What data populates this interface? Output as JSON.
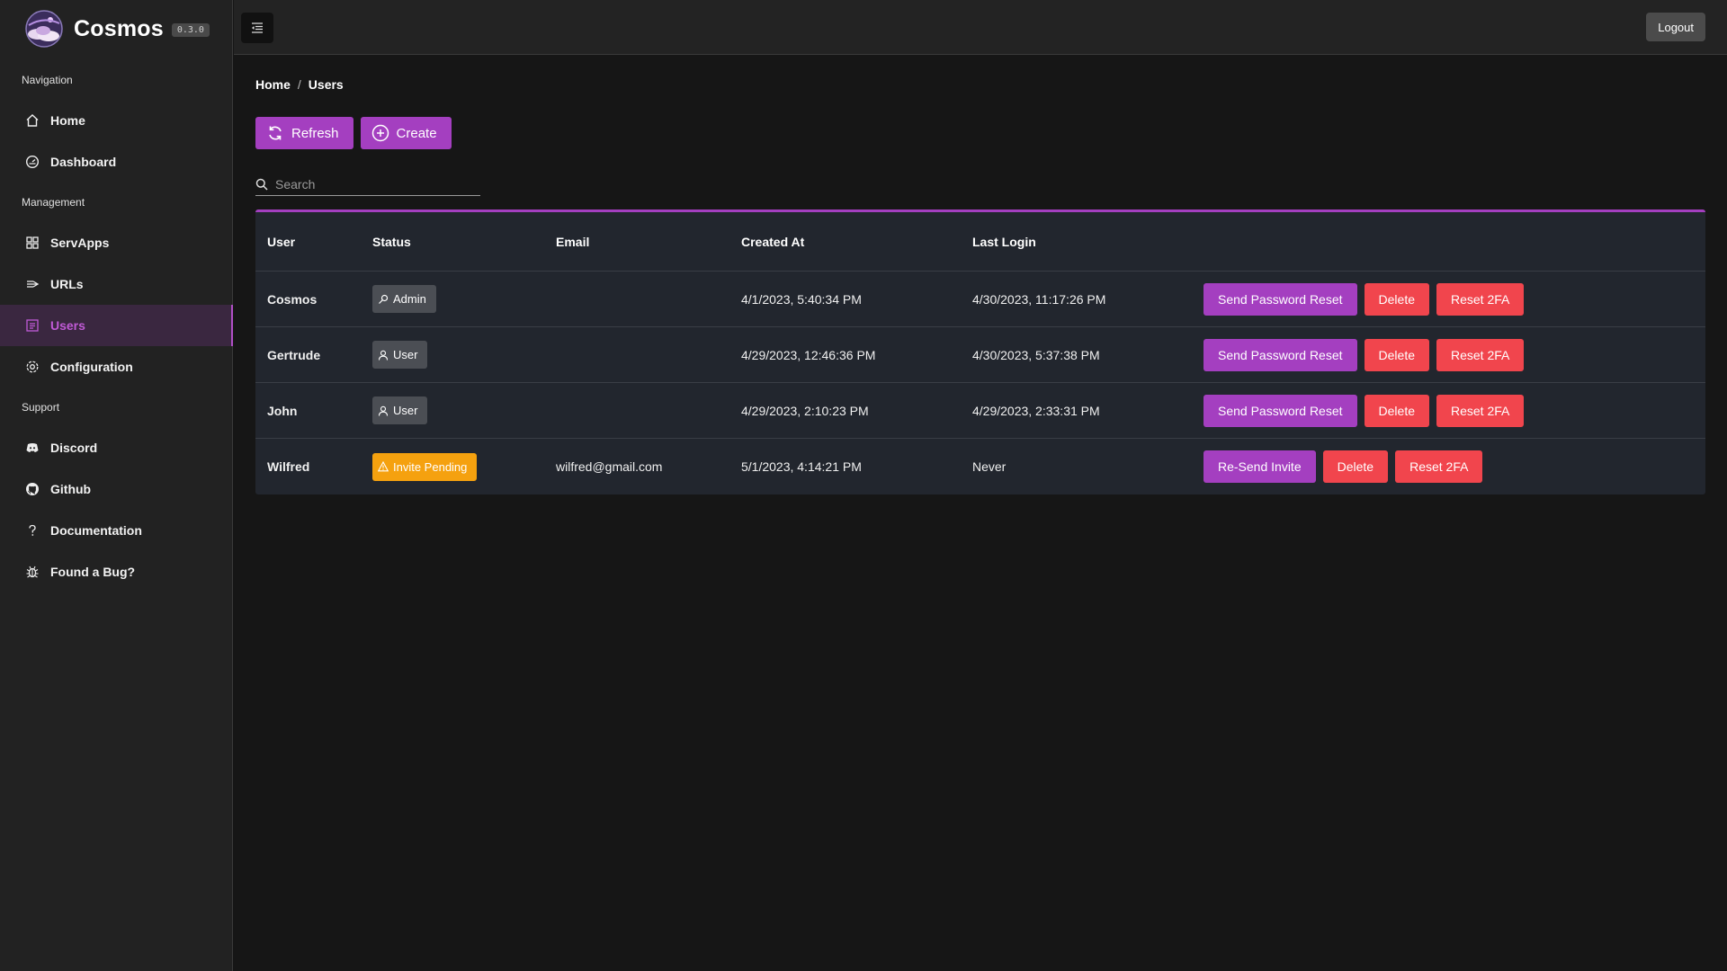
{
  "app": {
    "name": "Cosmos",
    "version": "0.3.0"
  },
  "colors": {
    "accent": "#a43fc0",
    "danger": "#f1454d",
    "warning": "#f5a10f"
  },
  "sidebar": {
    "sections": [
      "Navigation",
      "Management",
      "Support"
    ],
    "items": [
      {
        "label": "Home",
        "icon": "home-icon"
      },
      {
        "label": "Dashboard",
        "icon": "dashboard-icon"
      },
      {
        "label": "ServApps",
        "icon": "grid-icon"
      },
      {
        "label": "URLs",
        "icon": "urls-icon"
      },
      {
        "label": "Users",
        "icon": "users-icon",
        "active": true
      },
      {
        "label": "Configuration",
        "icon": "gear-icon"
      },
      {
        "label": "Discord",
        "icon": "discord-icon"
      },
      {
        "label": "Github",
        "icon": "github-icon"
      },
      {
        "label": "Documentation",
        "icon": "question-icon"
      },
      {
        "label": "Found a Bug?",
        "icon": "bug-icon"
      }
    ]
  },
  "header": {
    "logout_label": "Logout"
  },
  "breadcrumb": {
    "home": "Home",
    "sep": "/",
    "current": "Users"
  },
  "toolbar": {
    "refresh_label": "Refresh",
    "create_label": "Create"
  },
  "search": {
    "placeholder": "Search"
  },
  "table": {
    "columns": [
      "User",
      "Status",
      "Email",
      "Created At",
      "Last Login"
    ],
    "rows": [
      {
        "user": "Cosmos",
        "status": "Admin",
        "status_icon": "key-icon",
        "email": "",
        "created": "4/1/2023, 5:40:34 PM",
        "last_login": "4/30/2023, 11:17:26 PM",
        "primary_action": "Send Password Reset",
        "delete": "Delete",
        "reset": "Reset 2FA"
      },
      {
        "user": "Gertrude",
        "status": "User",
        "status_icon": "user-icon",
        "email": "",
        "created": "4/29/2023, 12:46:36 PM",
        "last_login": "4/30/2023, 5:37:38 PM",
        "primary_action": "Send Password Reset",
        "delete": "Delete",
        "reset": "Reset 2FA"
      },
      {
        "user": "John",
        "status": "User",
        "status_icon": "user-icon",
        "email": "",
        "created": "4/29/2023, 2:10:23 PM",
        "last_login": "4/29/2023, 2:33:31 PM",
        "primary_action": "Send Password Reset",
        "delete": "Delete",
        "reset": "Reset 2FA"
      },
      {
        "user": "Wilfred",
        "status": "Invite Pending",
        "status_icon": "warning-icon",
        "email": "wilfred@gmail.com",
        "created": "5/1/2023, 4:14:21 PM",
        "last_login": "Never",
        "primary_action": "Re-Send Invite",
        "delete": "Delete",
        "reset": "Reset 2FA"
      }
    ]
  }
}
